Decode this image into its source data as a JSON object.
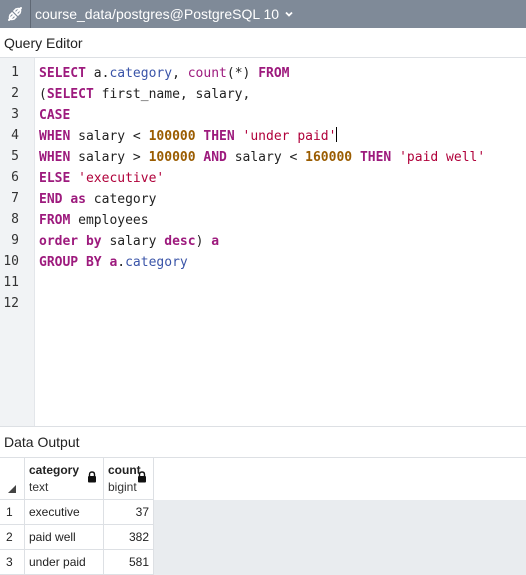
{
  "titlebar": {
    "connection": "course_data/postgres@PostgreSQL 10",
    "icon": "connection-icon"
  },
  "query_editor": {
    "title": "Query Editor",
    "line_numbers": [
      "1",
      "2",
      "3",
      "4",
      "5",
      "6",
      "7",
      "8",
      "9",
      "10",
      "11",
      "12"
    ],
    "lines": [
      [
        {
          "t": "kw",
          "v": "SELECT"
        },
        {
          "t": "txt",
          "v": " a."
        },
        {
          "t": "prop",
          "v": "category"
        },
        {
          "t": "txt",
          "v": ", "
        },
        {
          "t": "fn",
          "v": "count"
        },
        {
          "t": "txt",
          "v": "(*) "
        },
        {
          "t": "kw",
          "v": "FROM"
        }
      ],
      [
        {
          "t": "txt",
          "v": "("
        },
        {
          "t": "kw",
          "v": "SELECT"
        },
        {
          "t": "txt",
          "v": " first_name, salary,"
        }
      ],
      [
        {
          "t": "kw",
          "v": "CASE"
        }
      ],
      [
        {
          "t": "kw",
          "v": "WHEN"
        },
        {
          "t": "txt",
          "v": " salary < "
        },
        {
          "t": "num",
          "v": "100000"
        },
        {
          "t": "txt",
          "v": " "
        },
        {
          "t": "kw",
          "v": "THEN"
        },
        {
          "t": "txt",
          "v": " "
        },
        {
          "t": "str",
          "v": "'under paid'"
        },
        {
          "t": "cursor",
          "v": ""
        }
      ],
      [
        {
          "t": "kw",
          "v": "WHEN"
        },
        {
          "t": "txt",
          "v": " salary > "
        },
        {
          "t": "num",
          "v": "100000"
        },
        {
          "t": "txt",
          "v": " "
        },
        {
          "t": "kw",
          "v": "AND"
        },
        {
          "t": "txt",
          "v": " salary < "
        },
        {
          "t": "num",
          "v": "160000"
        },
        {
          "t": "txt",
          "v": " "
        },
        {
          "t": "kw",
          "v": "THEN"
        },
        {
          "t": "txt",
          "v": " "
        },
        {
          "t": "str",
          "v": "'paid well'"
        }
      ],
      [
        {
          "t": "kw",
          "v": "ELSE"
        },
        {
          "t": "txt",
          "v": " "
        },
        {
          "t": "str",
          "v": "'executive'"
        }
      ],
      [
        {
          "t": "kw",
          "v": "END"
        },
        {
          "t": "txt",
          "v": " "
        },
        {
          "t": "kw",
          "v": "as"
        },
        {
          "t": "txt",
          "v": " category"
        }
      ],
      [
        {
          "t": "kw",
          "v": "FROM"
        },
        {
          "t": "txt",
          "v": " employees"
        }
      ],
      [
        {
          "t": "kw",
          "v": "order"
        },
        {
          "t": "txt",
          "v": " "
        },
        {
          "t": "kw",
          "v": "by"
        },
        {
          "t": "txt",
          "v": " salary "
        },
        {
          "t": "kw",
          "v": "desc"
        },
        {
          "t": "txt",
          "v": ") "
        },
        {
          "t": "kw",
          "v": "a"
        }
      ],
      [
        {
          "t": "kw",
          "v": "GROUP"
        },
        {
          "t": "txt",
          "v": " "
        },
        {
          "t": "kw",
          "v": "BY"
        },
        {
          "t": "txt",
          "v": " "
        },
        {
          "t": "kw",
          "v": "a"
        },
        {
          "t": "txt",
          "v": "."
        },
        {
          "t": "prop",
          "v": "category"
        }
      ],
      [],
      []
    ]
  },
  "data_output": {
    "title": "Data Output",
    "columns": [
      {
        "name": "category",
        "type": "text"
      },
      {
        "name": "count",
        "type": "bigint"
      }
    ],
    "rows": [
      {
        "num": "1",
        "category": "executive",
        "count": "37"
      },
      {
        "num": "2",
        "category": "paid well",
        "count": "382"
      },
      {
        "num": "3",
        "category": "under paid",
        "count": "581"
      }
    ]
  },
  "colors": {
    "titlebar_bg": "#7f8a98",
    "keyword": "#9d1a7d",
    "number": "#9a5c00",
    "string": "#b0003a",
    "property": "#3a54a8"
  }
}
